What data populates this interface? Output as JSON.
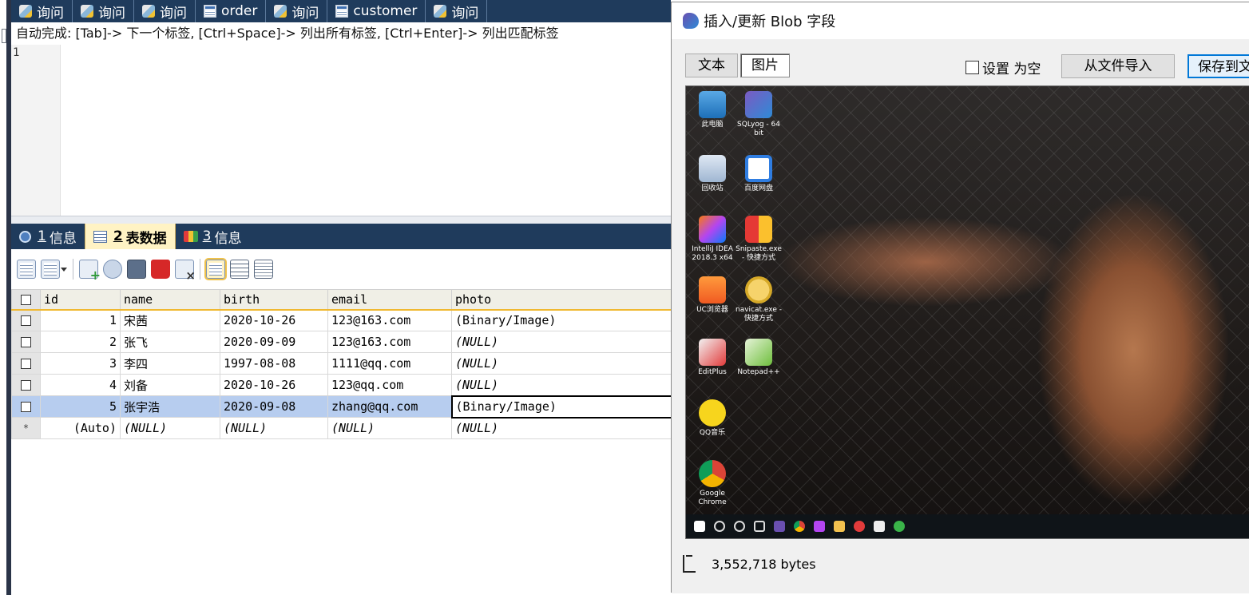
{
  "query_tabs": [
    {
      "label": "询问",
      "icon": "query-icon"
    },
    {
      "label": "询问",
      "icon": "query-icon"
    },
    {
      "label": "询问",
      "icon": "query-icon"
    },
    {
      "label": "order",
      "icon": "table-icon"
    },
    {
      "label": "询问",
      "icon": "query-icon"
    },
    {
      "label": "customer",
      "icon": "table-icon"
    },
    {
      "label": "询问",
      "icon": "query-icon"
    }
  ],
  "editor": {
    "autocomplete_hint": "自动完成: [Tab]-> 下一个标签, [Ctrl+Space]-> 列出所有标签, [Ctrl+Enter]-> 列出匹配标签",
    "line_number": "1"
  },
  "result_tabs": [
    {
      "num": "1",
      "label": "信息"
    },
    {
      "num": "2",
      "label": "表数据"
    },
    {
      "num": "3",
      "label": "信息"
    }
  ],
  "grid": {
    "columns": [
      "id",
      "name",
      "birth",
      "email",
      "photo"
    ],
    "rows": [
      {
        "id": "1",
        "name": "宋茜",
        "birth": "2020-10-26",
        "email": "123@163.com",
        "photo": "(Binary/Image)"
      },
      {
        "id": "2",
        "name": "张飞",
        "birth": "2020-09-09",
        "email": "123@163.com",
        "photo": "(NULL)"
      },
      {
        "id": "3",
        "name": "李四",
        "birth": "1997-08-08",
        "email": "1111@qq.com",
        "photo": "(NULL)"
      },
      {
        "id": "4",
        "name": "刘备",
        "birth": "2020-10-26",
        "email": "123@qq.com",
        "photo": "(NULL)"
      },
      {
        "id": "5",
        "name": "张宇浩",
        "birth": "2020-09-08",
        "email": "zhang@qq.com",
        "photo": "(Binary/Image)"
      }
    ],
    "new_row": {
      "marker": "*",
      "id": "(Auto)",
      "name": "(NULL)",
      "birth": "(NULL)",
      "email": "(NULL)",
      "photo": "(NULL)"
    }
  },
  "dialog": {
    "title": "插入/更新 Blob 字段",
    "tab_text": "文本",
    "tab_image": "图片",
    "set_null_label": "设置 为空",
    "import_button": "从文件导入",
    "save_button": "保存到文",
    "size_text": "3,552,718 bytes",
    "desktop_icons": [
      {
        "label": "此电脑"
      },
      {
        "label": "SQLyog - 64 bit"
      },
      {
        "label": "回收站"
      },
      {
        "label": "百度网盘"
      },
      {
        "label": "IntelliJ IDEA 2018.3 x64"
      },
      {
        "label": "Snipaste.exe - 快捷方式"
      },
      {
        "label": "UC浏览器"
      },
      {
        "label": "navicat.exe - 快捷方式"
      },
      {
        "label": "EditPlus"
      },
      {
        "label": "Notepad++"
      },
      {
        "label": "QQ音乐"
      },
      {
        "label": "Google Chrome"
      }
    ]
  }
}
